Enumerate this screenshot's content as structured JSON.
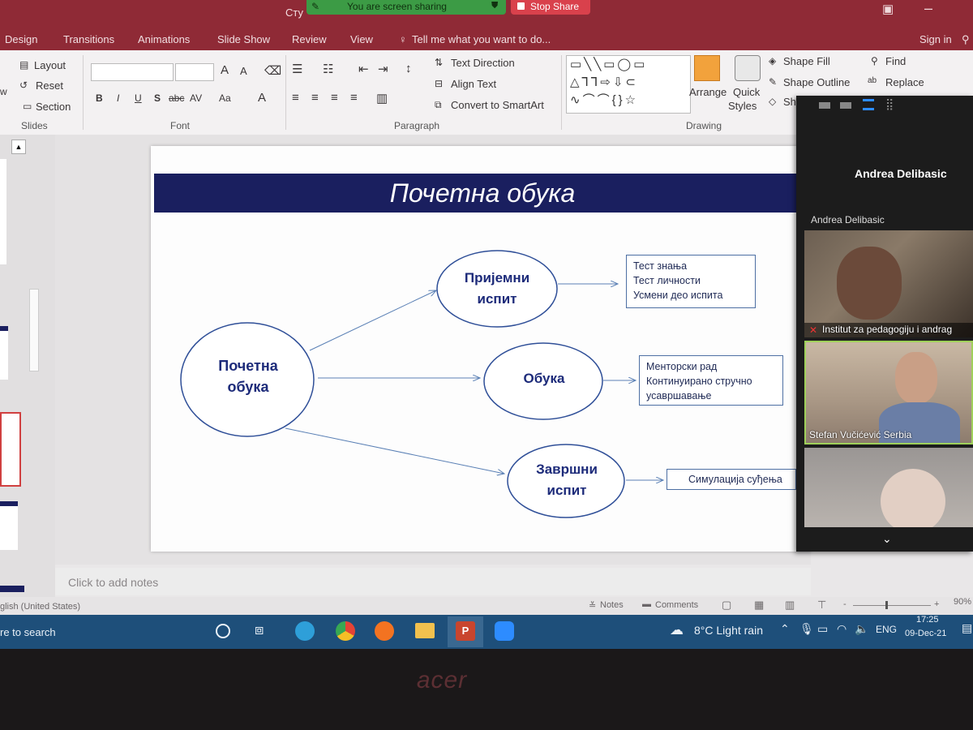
{
  "window": {
    "title_fragment": "Сту",
    "sign_in": "Sign in"
  },
  "sharing": {
    "banner": "You are screen sharing",
    "stop": "Stop Share"
  },
  "tabs": [
    "Design",
    "Transitions",
    "Animations",
    "Slide Show",
    "Review",
    "View"
  ],
  "tell_me": "Tell me what you want to do...",
  "ribbon": {
    "slides": {
      "layout": "Layout",
      "reset": "Reset",
      "section": "Section",
      "new_fragment": "w",
      "group": "Slides"
    },
    "font": {
      "group": "Font",
      "bold": "B",
      "italic": "I",
      "underline": "U",
      "shadow": "S",
      "strike": "abc",
      "spacing": "AV",
      "case": "Aa",
      "grow": "A",
      "shrink": "A",
      "color": "A"
    },
    "paragraph": {
      "group": "Paragraph",
      "text_direction": "Text Direction",
      "align_text": "Align Text",
      "convert_smartart": "Convert to SmartArt"
    },
    "drawing": {
      "group": "Drawing",
      "arrange": "Arrange",
      "quick_styles_1": "Quick",
      "quick_styles_2": "Styles",
      "shape_fill": "Shape Fill",
      "shape_outline": "Shape Outline",
      "shape_effects": "Shape"
    },
    "editing": {
      "find": "Find",
      "replace": "Replace"
    }
  },
  "slide": {
    "title": "Почетна обука",
    "center": [
      "Почетна",
      "обука"
    ],
    "node1": [
      "Пријемни",
      "испит"
    ],
    "node2": [
      "Обука"
    ],
    "node3": [
      "Завршни",
      "испит"
    ],
    "box1": [
      "Тест знања",
      "Тест личности",
      "Усмени део испита"
    ],
    "box2": [
      "Менторски рад",
      "Континуирано стручно",
      "усавршавање"
    ],
    "box3": [
      "Симулација суђења"
    ]
  },
  "notes_placeholder": "Click to add notes",
  "status": {
    "language": "glish (United States)",
    "notes": "Notes",
    "comments": "Comments",
    "zoom": "90%",
    "minus": "-",
    "plus": "+"
  },
  "taskbar": {
    "search": "re to search",
    "weather": "8°C  Light rain",
    "lang": "ENG",
    "time": "17:25",
    "date": "09-Dec-21"
  },
  "zoom": {
    "speaker_header": "Andrea Delibasic",
    "speaker_label": "Andrea Delibasic",
    "participants": [
      "Institut za pedagogiju i andrag",
      "Stefan Vučićević Serbia",
      ""
    ]
  },
  "colors": {
    "ribbon_red": "#8f2a36",
    "slide_title_bg": "#1a1f5f",
    "node_text": "#1d2b7a",
    "taskbar": "#1e4f7a"
  },
  "bezel_logo": "acer"
}
